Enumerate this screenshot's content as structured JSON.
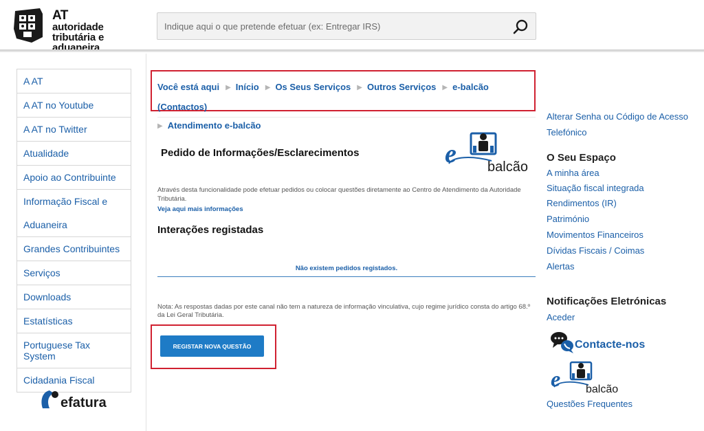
{
  "header": {
    "logo": {
      "line1": "AT",
      "line2": "autoridade",
      "line3": "tributária e aduaneira"
    },
    "search": {
      "placeholder": "Indique aqui o que pretende efetuar (ex: Entregar IRS)",
      "icon": "search-icon"
    }
  },
  "leftnav": {
    "items": [
      "A AT",
      "A AT no Youtube",
      "A AT no Twitter",
      "Atualidade",
      "Apoio ao Contribuinte",
      "Informação Fiscal e Aduaneira",
      "Grandes Contribuintes",
      "Serviços",
      "Downloads",
      "Estatísticas",
      "Portuguese Tax System",
      "Cidadania Fiscal"
    ],
    "efatura_logo": "efatura"
  },
  "breadcrumb": {
    "items": [
      "Você está aqui",
      "Início",
      "Os Seus Serviços",
      "Outros Serviços",
      "e-balcão (Contactos)",
      "Atendimento e-balcão"
    ]
  },
  "main": {
    "title": "Pedido de Informações/Esclarecimentos",
    "ebalcao_logo": {
      "letter": "e",
      "word": "balcão"
    },
    "description": "Através desta funcionalidade pode efetuar pedidos ou colocar questões diretamente ao Centro de Atendimento da Autoridade Tributária.",
    "more_link": "Veja aqui mais informações",
    "interactions_title": "Interações registadas",
    "empty_message": "Não existem pedidos registados.",
    "note": "Nota: As respostas dadas por este canal não tem a natureza de informação vinculativa, cujo regime jurídico consta do artigo 68.º da Lei Geral Tributária.",
    "register_button": "REGISTAR NOVA QUESTÃO"
  },
  "right": {
    "change_password_line1": "Alterar Senha ou Código de Acesso",
    "change_password_line2": "Telefónico",
    "my_space_title": "O Seu Espaço",
    "my_space_links": [
      "A minha área",
      "Situação fiscal integrada",
      "Rendimentos (IR)",
      "Património",
      "Movimentos Financeiros",
      "Dívidas Fiscais / Coimas",
      "Alertas"
    ],
    "notifications_title": "Notificações Eletrónicas",
    "notifications_link": "Aceder",
    "contact_label": "Contacte-nos",
    "ebalcao_word": "balcão",
    "ebalcao_letter": "e",
    "faq_link": "Questões Frequentes"
  },
  "colors": {
    "link": "#1b5fa8",
    "highlight": "#d02030",
    "button": "#1e7bc6"
  }
}
